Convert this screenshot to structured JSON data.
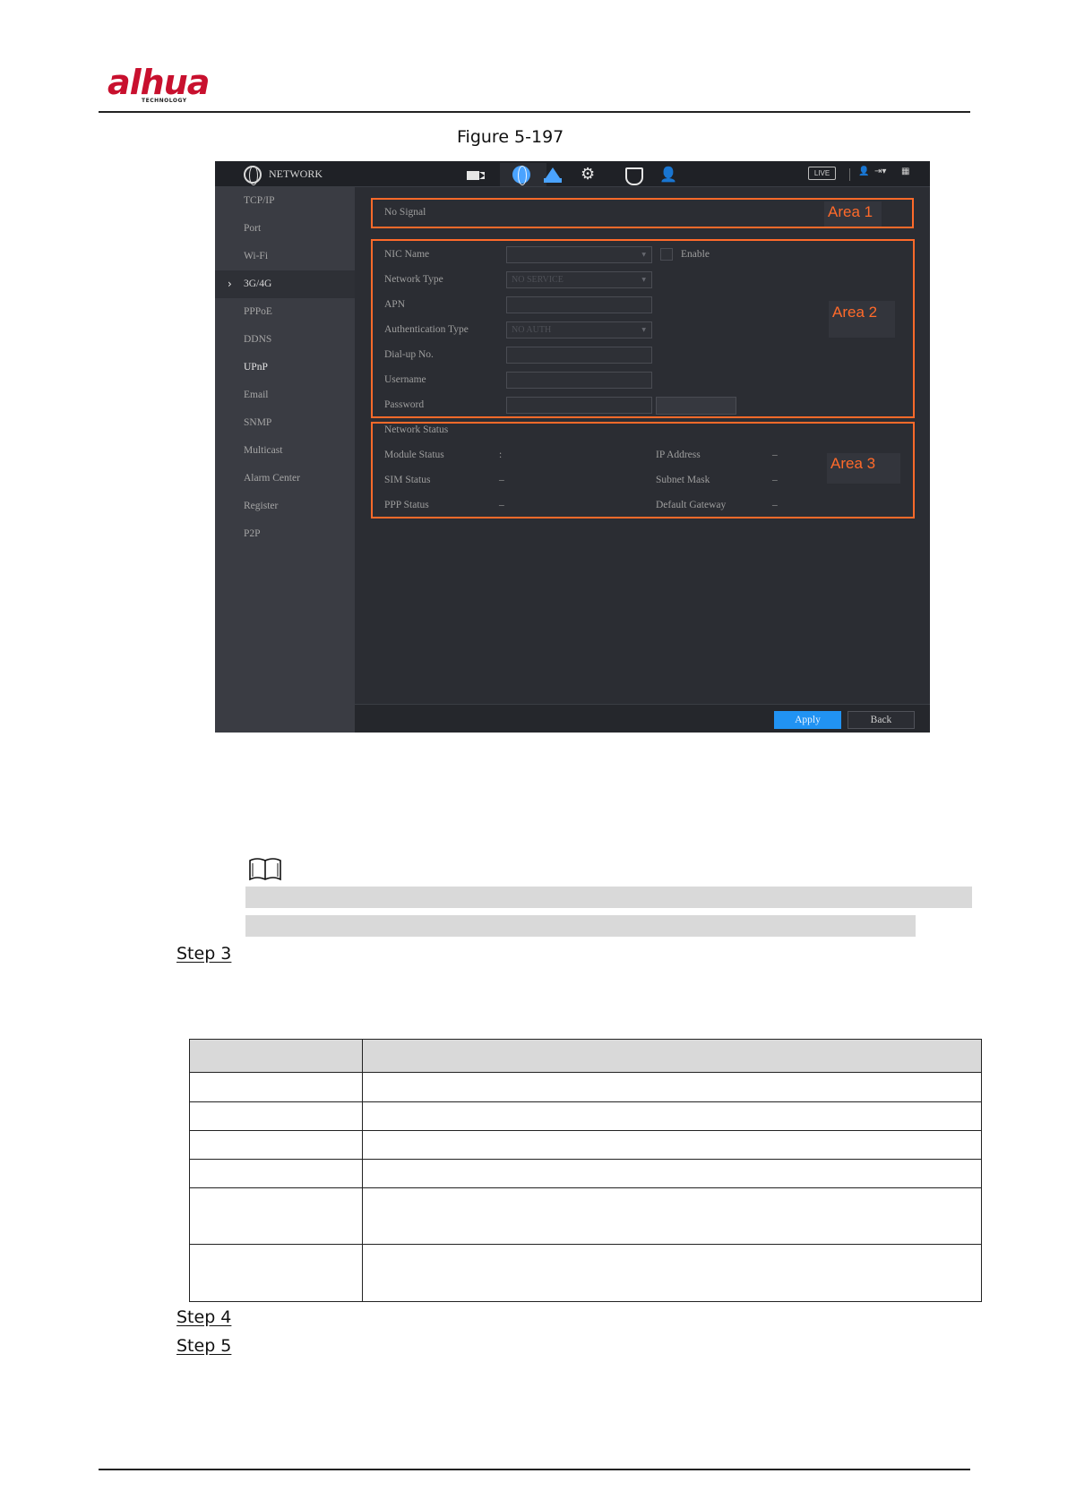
{
  "header": {
    "logo_text": "alhua",
    "logo_sub": "TECHNOLOGY"
  },
  "figure": {
    "caption": "Figure 5-197"
  },
  "screenshot": {
    "topbar": {
      "title": "NETWORK",
      "icons": [
        "camera-icon",
        "network-globe-icon",
        "storage-icon",
        "settings-gear-icon",
        "security-shield-icon",
        "account-icon"
      ],
      "active_icon": "network-globe-icon",
      "live_label": "LIVE"
    },
    "sidebar": {
      "items": [
        {
          "label": "TCP/IP"
        },
        {
          "label": "Port"
        },
        {
          "label": "Wi-Fi"
        },
        {
          "label": "3G/4G"
        },
        {
          "label": "PPPoE"
        },
        {
          "label": "DDNS"
        },
        {
          "label": "UPnP"
        },
        {
          "label": "Email"
        },
        {
          "label": "SNMP"
        },
        {
          "label": "Multicast"
        },
        {
          "label": "Alarm Center"
        },
        {
          "label": "Register"
        },
        {
          "label": "P2P"
        }
      ],
      "selected": "3G/4G"
    },
    "area1": {
      "signal_text": "No Signal",
      "label": "Area 1"
    },
    "area2": {
      "label": "Area 2",
      "nic_name_label": "NIC Name",
      "enable_label": "Enable",
      "network_type_label": "Network Type",
      "network_type_value": "NO SERVICE",
      "apn_label": "APN",
      "auth_type_label": "Authentication Type",
      "auth_type_value": "NO AUTH",
      "dialup_label": "Dial-up No.",
      "username_label": "Username",
      "password_label": "Password"
    },
    "area3": {
      "label": "Area 3",
      "title": "Network Status",
      "module_status_label": "Module Status",
      "module_status_value": ":",
      "sim_status_label": "SIM Status",
      "sim_status_value": "–",
      "ppp_status_label": "PPP Status",
      "ppp_status_value": "–",
      "ip_address_label": "IP Address",
      "ip_address_value": "–",
      "subnet_mask_label": "Subnet Mask",
      "subnet_mask_value": "–",
      "default_gateway_label": "Default Gateway",
      "default_gateway_value": "–"
    },
    "buttons": {
      "apply": "Apply",
      "back": "Back"
    },
    "colors": {
      "highlight": "#ff6a2a",
      "apply_blue": "#2193f3"
    }
  },
  "steps": {
    "step3": "Step 3",
    "step4": "Step 4",
    "step5": "Step 5"
  }
}
